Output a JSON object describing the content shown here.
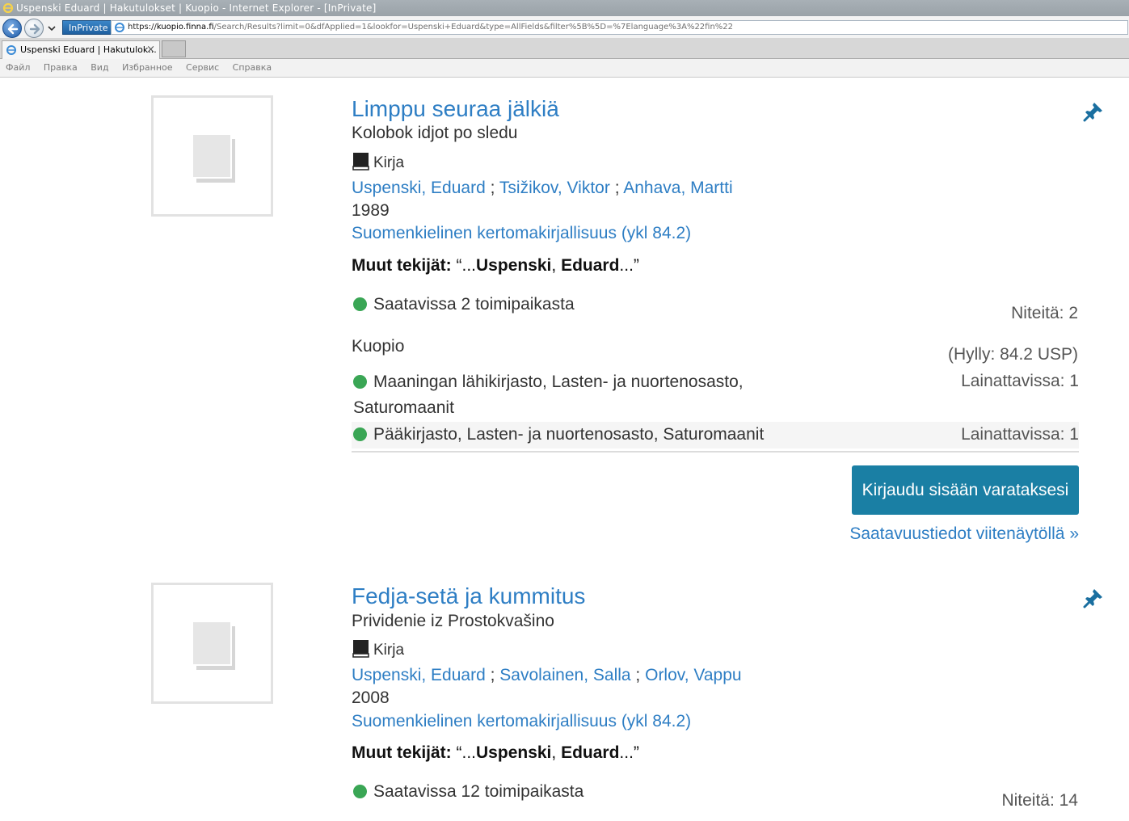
{
  "window": {
    "title": "Uspenski Eduard | Hakutulokset | Kuopio - Internet Explorer - [InPrivate]",
    "inprivate_label": "InPrivate",
    "url_scheme": "https://",
    "url_host": "kuopio.finna.fi",
    "url_path": "/Search/Results?limit=0&dfApplied=1&lookfor=Uspenski+Eduard&type=AllFields&filter%5B%5D=%7Elanguage%3A%22fin%22",
    "tab_label": "Uspenski Eduard | Hakutulok...",
    "tab_close": "×",
    "menu": [
      "Файл",
      "Правка",
      "Вид",
      "Избранное",
      "Сервис",
      "Справка"
    ]
  },
  "results": [
    {
      "title": "Limppu seuraa jälkiä",
      "subtitle": "Kolobok idjot po sledu",
      "format": "Kirja",
      "authors": [
        "Uspenski, Eduard",
        "Tsižikov, Viktor",
        "Anhava, Martti"
      ],
      "author_sep": ";",
      "year": "1989",
      "subject": "Suomenkielinen kertomakirjallisuus (ykl 84.2)",
      "other_label": "Muut tekijät:",
      "other_open": "“...",
      "other_name1": "Uspenski",
      "other_comma": ", ",
      "other_name2": "Eduard",
      "other_close": "...”",
      "availability": "Saatavissa 2 toimipaikasta",
      "copies": "Niteitä: 2",
      "branch": "Kuopio",
      "shelf": "(Hylly: 84.2 USP)",
      "locations": [
        {
          "name": "Maaningan lähikirjasto, Lasten- ja nuortenosasto, Saturomaanit",
          "count": "Lainattavissa: 1"
        },
        {
          "name": "Pääkirjasto, Lasten- ja nuortenosasto, Saturomaanit",
          "count": "Lainattavissa: 1"
        }
      ],
      "login_button": "Kirjaudu sisään varataksesi",
      "more_link": "Saatavuustiedot viitenäytöllä »"
    },
    {
      "title": "Fedja-setä ja kummitus",
      "subtitle": "Prividenie iz Prostokvašino",
      "format": "Kirja",
      "authors": [
        "Uspenski, Eduard",
        "Savolainen, Salla",
        "Orlov, Vappu"
      ],
      "author_sep": ";",
      "year": "2008",
      "subject": "Suomenkielinen kertomakirjallisuus (ykl 84.2)",
      "other_label": "Muut tekijät:",
      "other_open": "“...",
      "other_name1": "Uspenski",
      "other_comma": ", ",
      "other_name2": "Eduard",
      "other_close": "...”",
      "availability": "Saatavissa 12 toimipaikasta",
      "copies": "Niteitä: 14"
    }
  ],
  "colors": {
    "link": "#2e7ec4",
    "available": "#3aa655",
    "button": "#1a7fa4",
    "pin": "#1a6fa0"
  },
  "icons": [
    "ie-logo-icon",
    "back-arrow-icon",
    "forward-arrow-icon",
    "pin-icon",
    "book-icon",
    "book-placeholder-icon",
    "available-dot-icon"
  ]
}
